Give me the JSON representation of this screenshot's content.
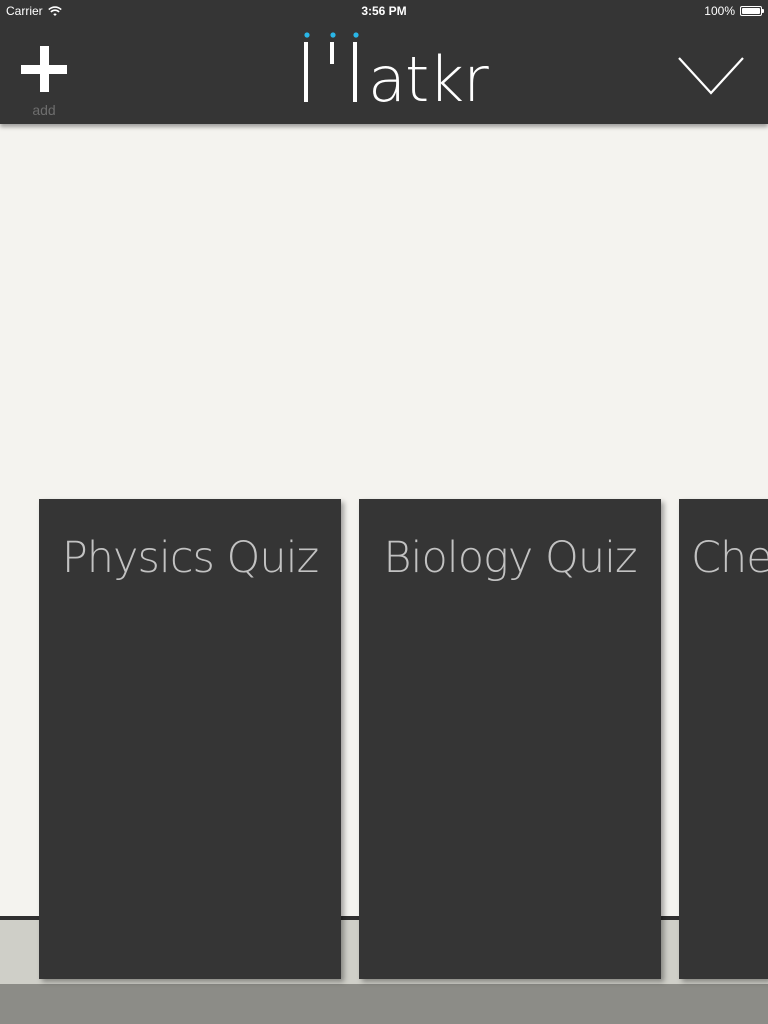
{
  "status_bar": {
    "carrier": "Carrier",
    "time": "3:56 PM",
    "battery": "100%",
    "battery_level": 1.0
  },
  "toolbar": {
    "add_label": "add",
    "logo_text": "atkr",
    "logo_dot_color": "#29b6e8"
  },
  "colors": {
    "header_bg": "#353535",
    "page_bg": "#f4f3ef",
    "card_bg": "#353535",
    "card_text": "#c2c2c2"
  },
  "quizzes": [
    {
      "title": "Physics Quiz"
    },
    {
      "title": "Biology Quiz"
    },
    {
      "title": "Che"
    }
  ]
}
